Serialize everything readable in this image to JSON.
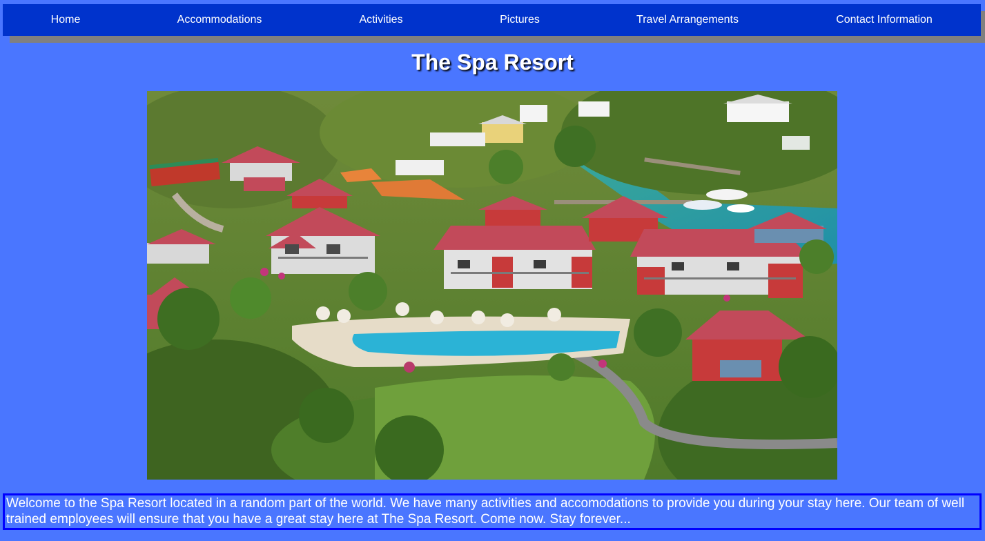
{
  "nav": {
    "items": [
      {
        "label": "Home"
      },
      {
        "label": "Accommodations"
      },
      {
        "label": "Activities"
      },
      {
        "label": "Pictures"
      },
      {
        "label": "Travel Arrangements"
      },
      {
        "label": "Contact Information"
      }
    ]
  },
  "header": {
    "title": "The Spa Resort"
  },
  "main": {
    "welcome_text": "Welcome to the Spa Resort located in a random part of the world. We have many activities and accomodations to provide you during your stay here. Our team of well trained employees will ensure that you have a great stay here at The Spa Resort. Come now. Stay forever..."
  },
  "colors": {
    "page_background": "#4a76ff",
    "nav_background": "#0033cc",
    "nav_shadow": "#808080",
    "welcome_border": "#0000ff",
    "text": "#ffffff"
  }
}
